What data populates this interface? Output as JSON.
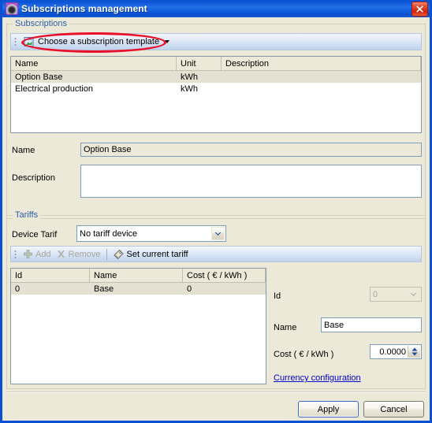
{
  "window": {
    "title": "Subscriptions management",
    "icon": "app-icon",
    "close_label": "×"
  },
  "subscriptions_group": {
    "label": "Subscriptions",
    "toolbar": {
      "template_button": "Choose a subscription template",
      "template_icon": "template-icon"
    },
    "table": {
      "columns": [
        "Name",
        "Unit",
        "Description"
      ],
      "rows": [
        {
          "name": "Option Base",
          "unit": "kWh",
          "description": "",
          "selected": true
        },
        {
          "name": "Electrical production",
          "unit": "kWh",
          "description": "",
          "selected": false
        }
      ]
    },
    "fields": {
      "name_label": "Name",
      "name_value": "Option Base",
      "description_label": "Description",
      "description_value": ""
    }
  },
  "tariffs_group": {
    "label": "Tariffs",
    "device_tarif_label": "Device Tarif",
    "device_tarif_value": "No tariff device",
    "toolbar": {
      "add_label": "Add",
      "add_icon": "plus-icon",
      "remove_label": "Remove",
      "remove_icon": "cross-icon",
      "set_current_label": "Set current tariff",
      "set_current_icon": "tag-icon"
    },
    "table": {
      "columns": [
        "Id",
        "Name",
        "Cost ( € / kWh )"
      ],
      "rows": [
        {
          "id": "0",
          "name": "Base",
          "cost": "0",
          "selected": true
        }
      ]
    },
    "detail": {
      "id_label": "Id",
      "id_value": "0",
      "name_label": "Name",
      "name_value": "Base",
      "cost_label": "Cost ( € / kWh )",
      "cost_value": "0.0000",
      "currency_link": "Currency configuration"
    }
  },
  "footer": {
    "apply_label": "Apply",
    "cancel_label": "Cancel"
  },
  "annotation": {
    "color": "#E8102A",
    "shape": "ellipse",
    "target": "Choose a subscription template"
  },
  "colors": {
    "title_bar": "#0A50D2",
    "dialog_bg": "#ECE9D8",
    "group_label": "#2C5FA8",
    "link": "#0000CC",
    "selection": "#E4E1D3",
    "annotation": "#E8102A"
  }
}
